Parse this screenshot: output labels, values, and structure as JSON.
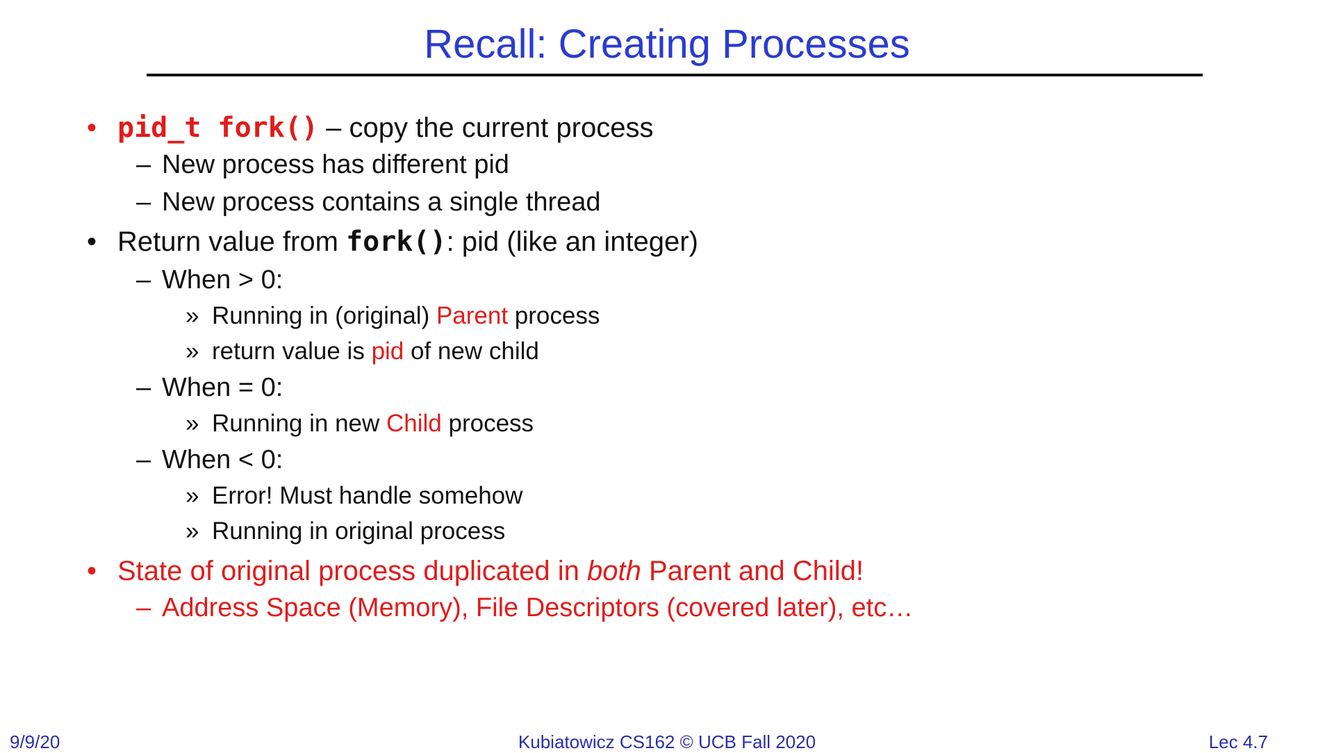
{
  "slide": {
    "title": "Recall: Creating Processes"
  },
  "bullets": {
    "b1_code": "pid_t fork()",
    "b1_text": " – copy the current process",
    "b1_sub1": "New process has different pid",
    "b1_sub2": "New process contains a single thread",
    "b2_text_a": "Return value from ",
    "b2_code": "fork()",
    "b2_text_b": ": pid (like an integer)",
    "b2_sub1": "When > 0:",
    "b2_sub1_i1_a": "Running in (original) ",
    "b2_sub1_i1_red": "Parent",
    "b2_sub1_i1_b": " process",
    "b2_sub1_i2_a": "return value is ",
    "b2_sub1_i2_red": "pid",
    "b2_sub1_i2_b": " of new child",
    "b2_sub2": "When = 0:",
    "b2_sub2_i1_a": "Running in new ",
    "b2_sub2_i1_red": "Child",
    "b2_sub2_i1_b": " process",
    "b2_sub3": "When < 0:",
    "b2_sub3_i1": "Error!  Must handle somehow",
    "b2_sub3_i2": "Running in original process",
    "b3_text_a": "State of original process duplicated in ",
    "b3_em": "both",
    "b3_text_b": " Parent and Child!",
    "b3_sub1": "Address Space (Memory), File Descriptors (covered later), etc…"
  },
  "markers": {
    "bullet": "•",
    "dash": "–",
    "chevron": "»"
  },
  "footer": {
    "date": "9/9/20",
    "course": "Kubiatowicz CS162 © UCB Fall 2020",
    "lecture": "Lec 4.7"
  },
  "colors": {
    "title": "#2a3bd1",
    "accent_red": "#e21b1b",
    "footer": "#2a2fa8",
    "text": "#111111"
  }
}
